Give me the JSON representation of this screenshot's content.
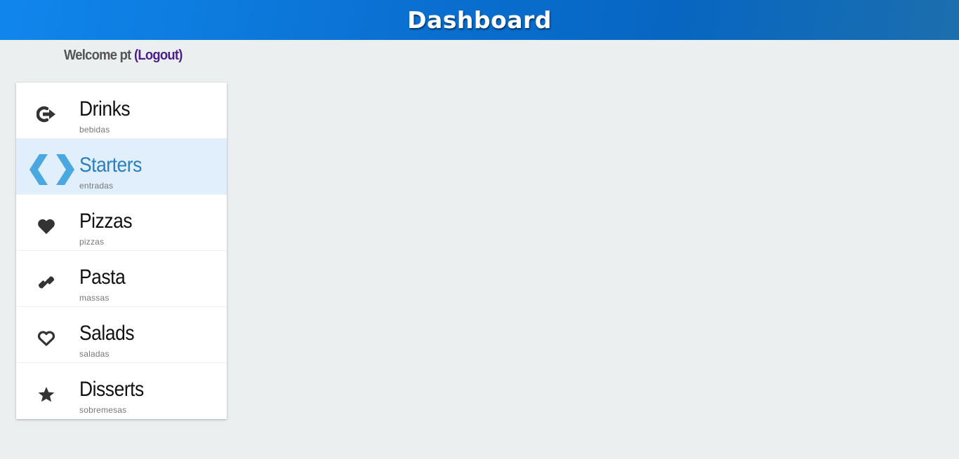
{
  "header": {
    "title": "Dashboard"
  },
  "welcome": {
    "text": "Welcome pt",
    "logout_label": "(Logout)"
  },
  "menu": {
    "items": [
      {
        "label": "Drinks",
        "sub": "bebidas",
        "icon": "sign-out-icon",
        "active": false
      },
      {
        "label": "Starters",
        "sub": "entradas",
        "icon": "code-icon",
        "active": true
      },
      {
        "label": "Pizzas",
        "sub": "pizzas",
        "icon": "heart-icon",
        "active": false
      },
      {
        "label": "Pasta",
        "sub": "massas",
        "icon": "link-icon",
        "active": false
      },
      {
        "label": "Salads",
        "sub": "saladas",
        "icon": "heart-outline-icon",
        "active": false
      },
      {
        "label": "Disserts",
        "sub": "sobremesas",
        "icon": "star-icon",
        "active": false
      }
    ]
  },
  "colors": {
    "header_gradient_start": "#1086ec",
    "header_gradient_end": "#1c6fae",
    "active_bg": "#e0effb",
    "active_text": "#2b7fbd",
    "active_icon": "#4aa8e0",
    "logout_link": "#4b1f8a",
    "page_bg": "#ebeff0"
  }
}
